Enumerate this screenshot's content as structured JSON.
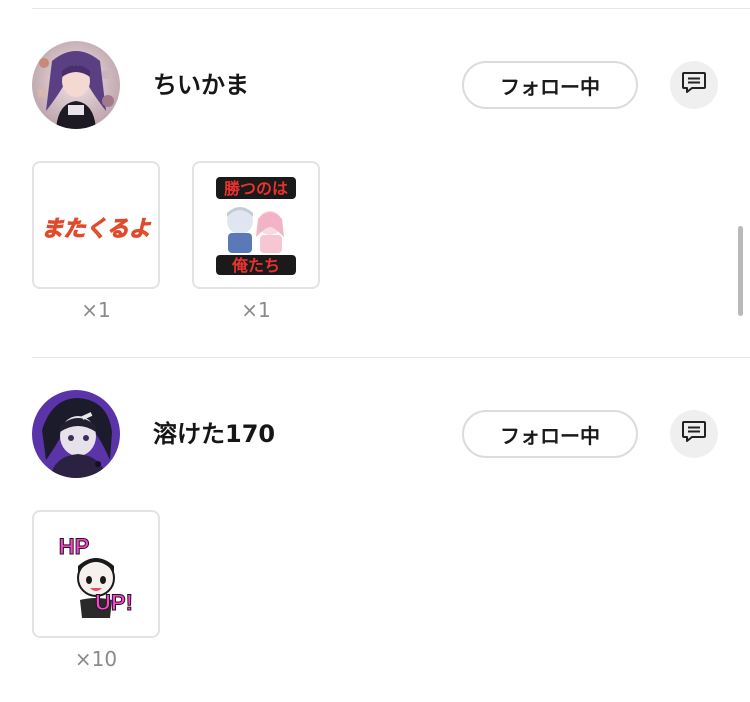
{
  "users": [
    {
      "name": "ちいかま",
      "follow_label": "フォロー中",
      "gifts": [
        {
          "count": "×1",
          "sticker_text": "またくるよ"
        },
        {
          "count": "×1",
          "sticker_text_top": "勝つのは",
          "sticker_text_bottom": "俺たち"
        }
      ]
    },
    {
      "name": "溶けた170",
      "follow_label": "フォロー中",
      "gifts": [
        {
          "count": "×10",
          "sticker_text_top": "HP",
          "sticker_text_bottom": "UP!"
        }
      ]
    }
  ],
  "colors": {
    "divider": "#e6e6e6",
    "button_border": "#dcdcdc",
    "message_bg": "#efefef",
    "count_text": "#8a8a8a"
  },
  "icons": [
    "message-icon"
  ]
}
